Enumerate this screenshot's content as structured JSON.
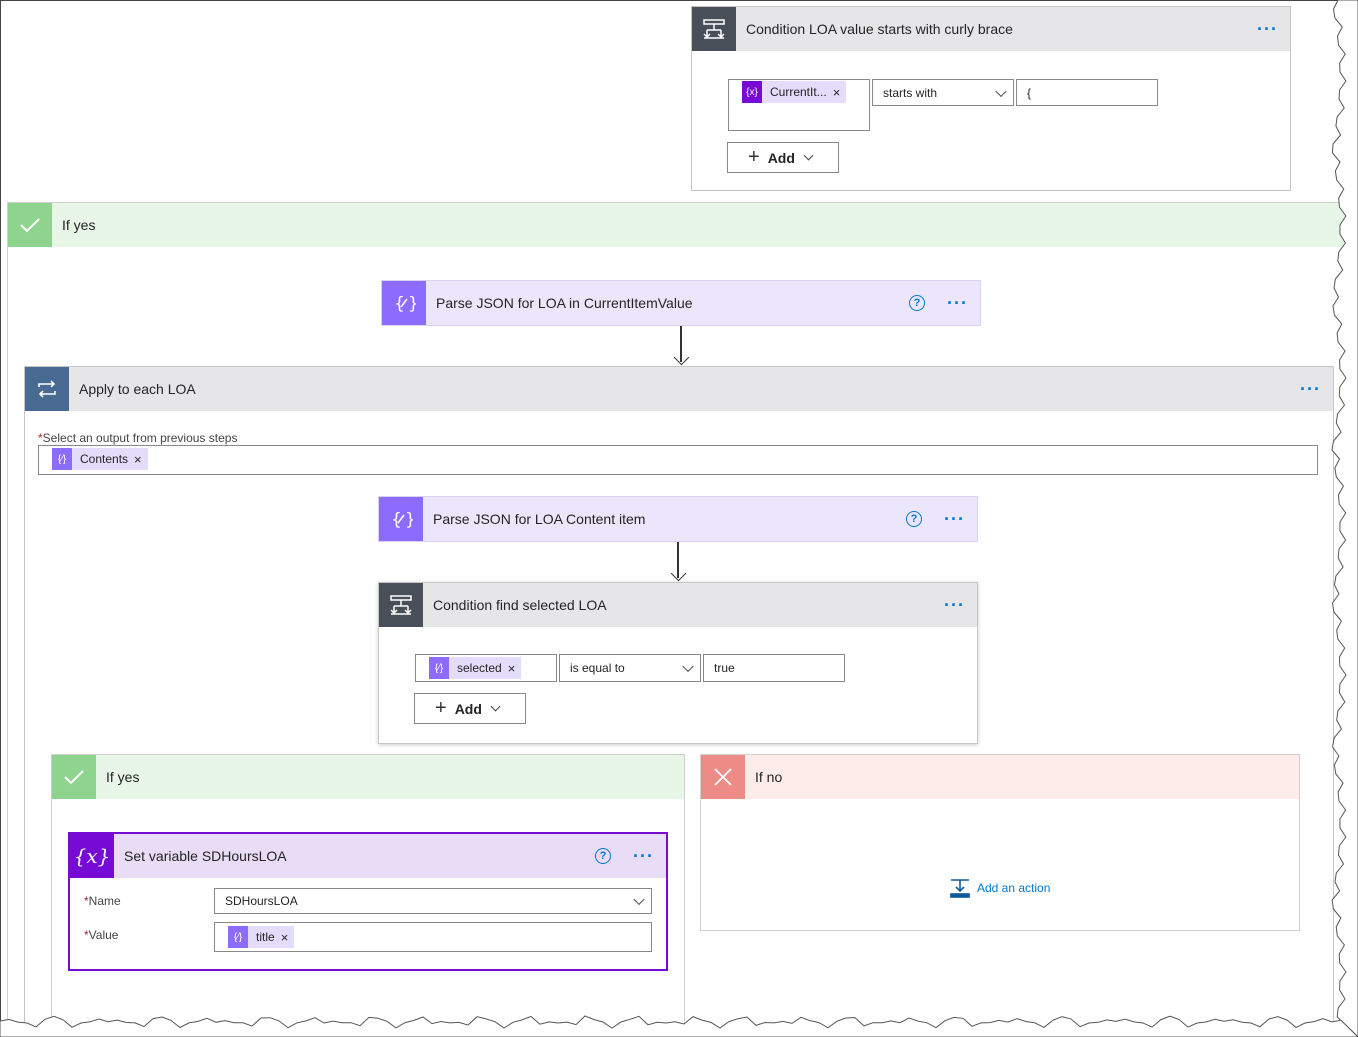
{
  "condition_top": {
    "title": "Condition LOA value starts with curly brace",
    "token": "CurrentIt...",
    "operator": "starts with",
    "value": "{",
    "add_label": "Add"
  },
  "if_yes_outer": {
    "label": "If yes"
  },
  "parse_json_1": {
    "title": "Parse JSON for LOA in CurrentItemValue"
  },
  "apply_each": {
    "title": "Apply to each LOA",
    "field_label": "Select an output from previous steps",
    "token": "Contents"
  },
  "parse_json_2": {
    "title": "Parse JSON for LOA Content item"
  },
  "condition_inner": {
    "title": "Condition find selected LOA",
    "token": "selected",
    "operator": "is equal to",
    "value": "true",
    "add_label": "Add"
  },
  "if_yes_inner": {
    "label": "If yes"
  },
  "if_no_inner": {
    "label": "If no",
    "add_action": "Add an action"
  },
  "set_variable": {
    "title": "Set variable SDHoursLOA",
    "name_label": "Name",
    "name_value": "SDHoursLOA",
    "value_label": "Value",
    "value_token": "title"
  },
  "colors": {
    "condition_icon": "#484f58",
    "parse_icon": "#8c6cff",
    "loop_icon": "#486991",
    "variable_icon": "#770bd6",
    "yes_branch": "#8ed48e",
    "no_branch": "#ed8b86",
    "link": "#0078d4"
  },
  "icons": [
    "condition-icon",
    "parse-json-icon",
    "loop-icon",
    "variable-icon",
    "check-icon",
    "close-icon",
    "help-icon",
    "more-icon",
    "add-action-icon"
  ]
}
